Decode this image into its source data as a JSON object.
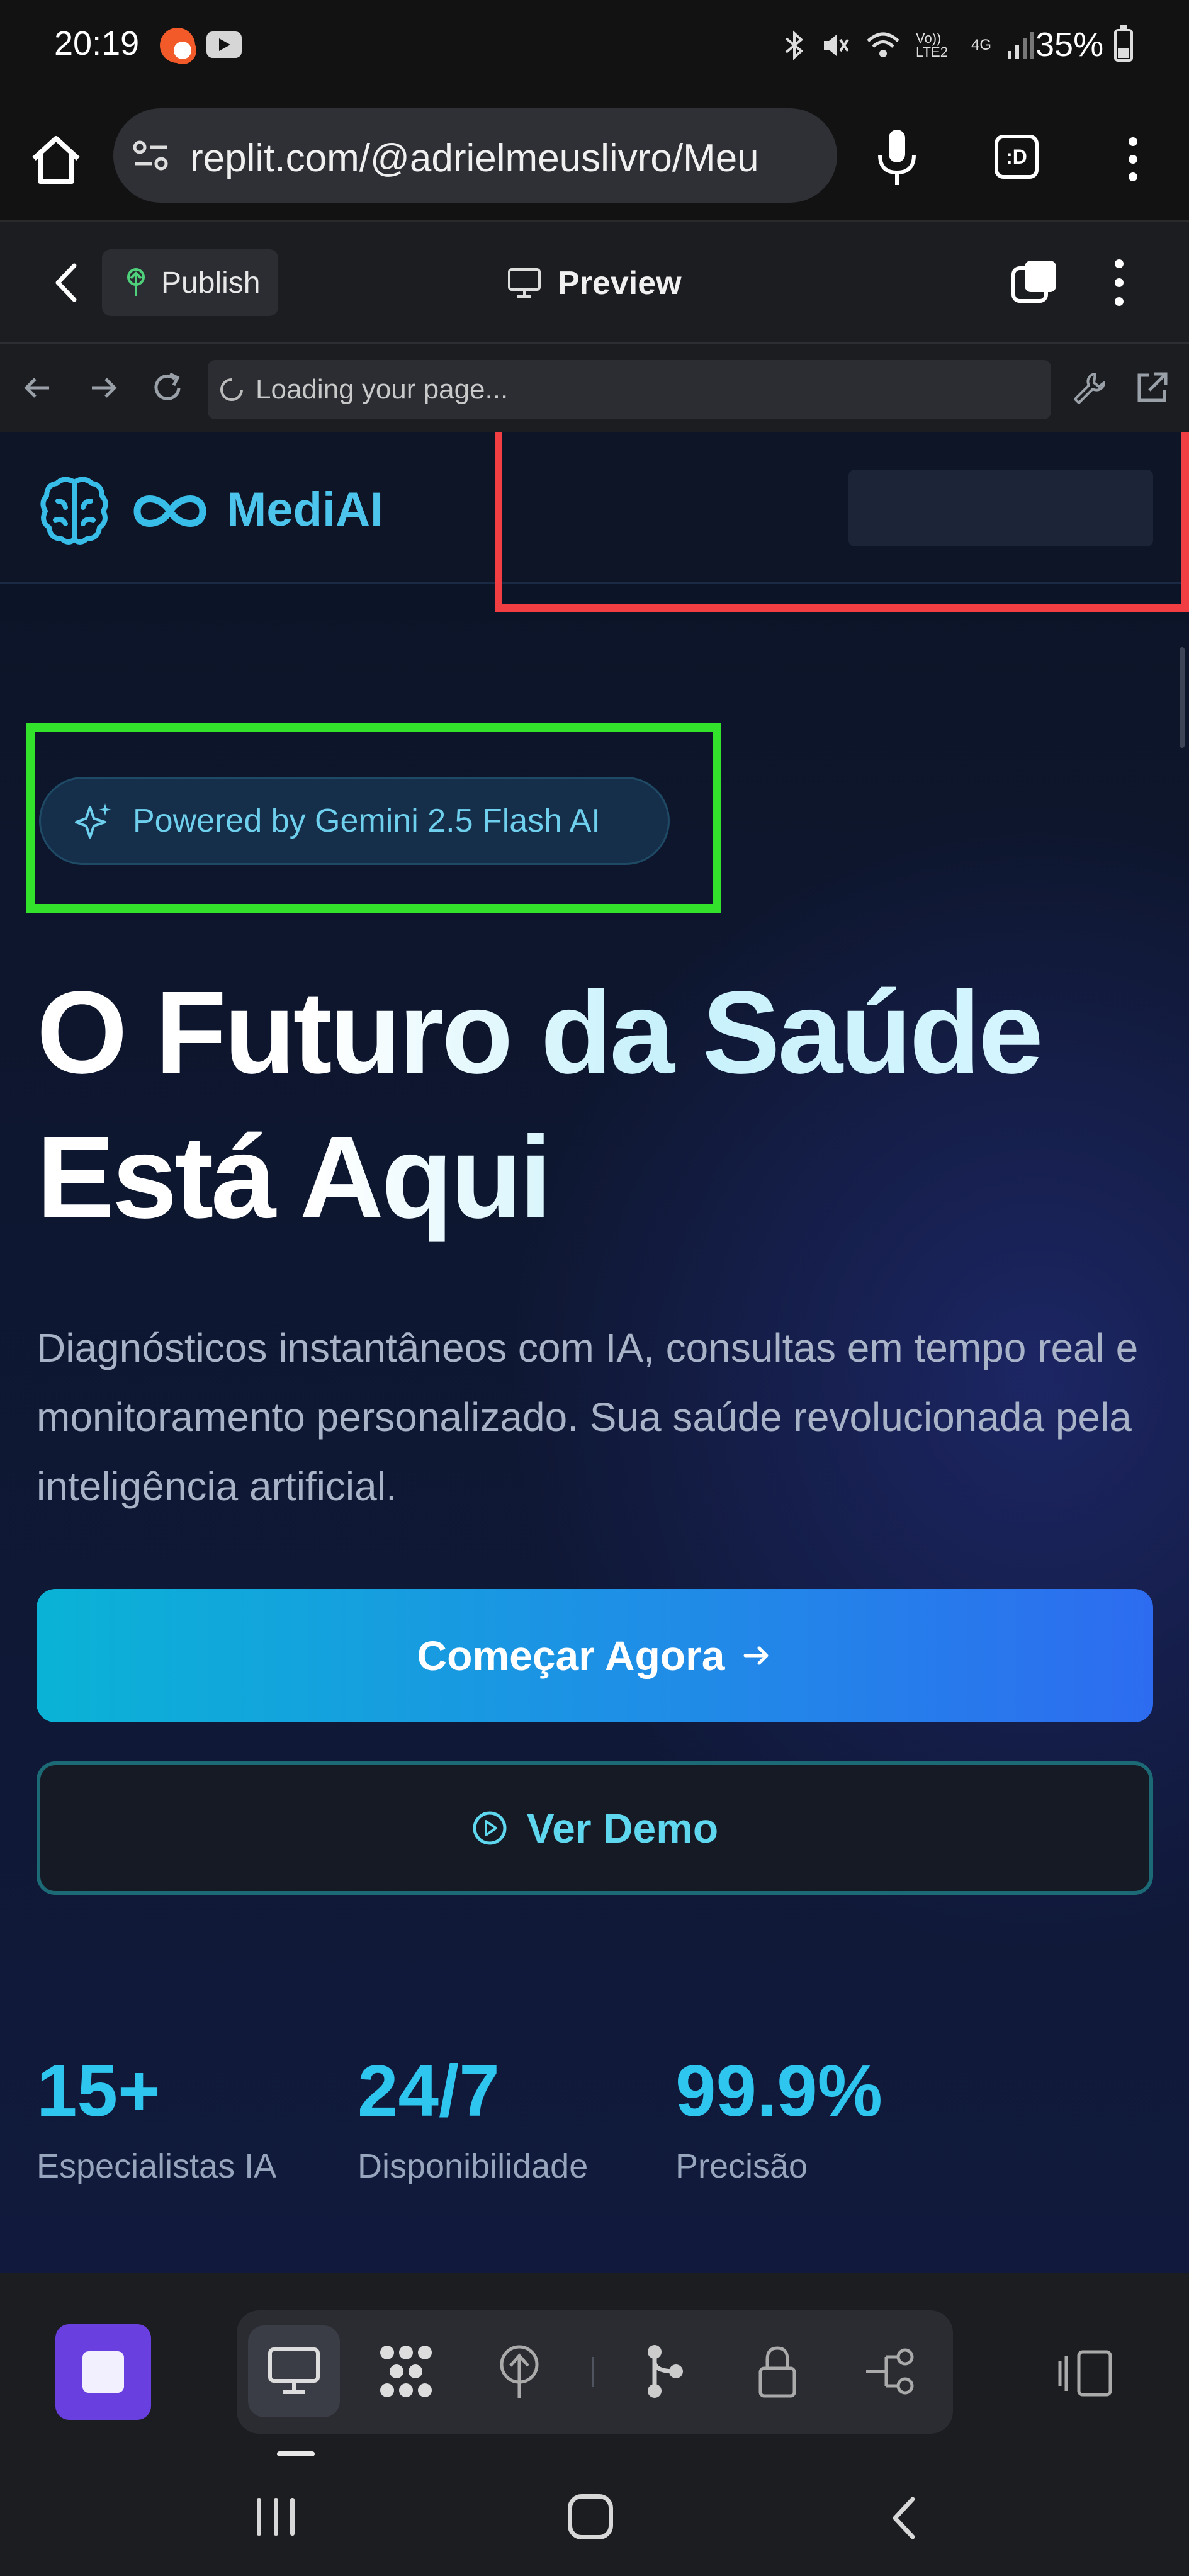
{
  "status_bar": {
    "time": "20:19",
    "battery": "35%",
    "icons": [
      "bluetooth-icon",
      "mute-icon",
      "wifi-icon",
      "volte-icon",
      "4g-icon",
      "signal-icon",
      "battery-icon"
    ],
    "volte_text": "Vo)) LTE2",
    "network_text": "4G"
  },
  "browser": {
    "url": "replit.com/@adrielmeuslivro/Meu",
    "tab_label": ":D"
  },
  "replit_toolbar": {
    "publish_label": "Publish",
    "preview_label": "Preview"
  },
  "webview": {
    "address_text": "Loading your page..."
  },
  "site": {
    "brand": "MediAI",
    "badge": "Powered by Gemini 2.5 Flash AI",
    "title_line1": "O Futuro da Saúde",
    "title_line2": "Está Aqui",
    "description": "Diagnósticos instantâneos com IA, consultas em tempo real e monitoramento personalizado. Sua saúde revolucionada pela inteligência artificial.",
    "cta_primary": "Começar Agora",
    "cta_secondary": "Ver Demo",
    "stats": [
      {
        "value": "15+",
        "label": "Especialistas IA"
      },
      {
        "value": "24/7",
        "label": "Disponibilidade"
      },
      {
        "value": "99.9%",
        "label": "Precisão"
      }
    ]
  },
  "colors": {
    "accent_cyan": "#2ec5ee",
    "cta_gradient_start": "#0ab3d6",
    "cta_gradient_end": "#2d6cf0",
    "annotation_red": "#f03e43",
    "annotation_green": "#33e22b",
    "stop_button": "#6a3fe0"
  }
}
